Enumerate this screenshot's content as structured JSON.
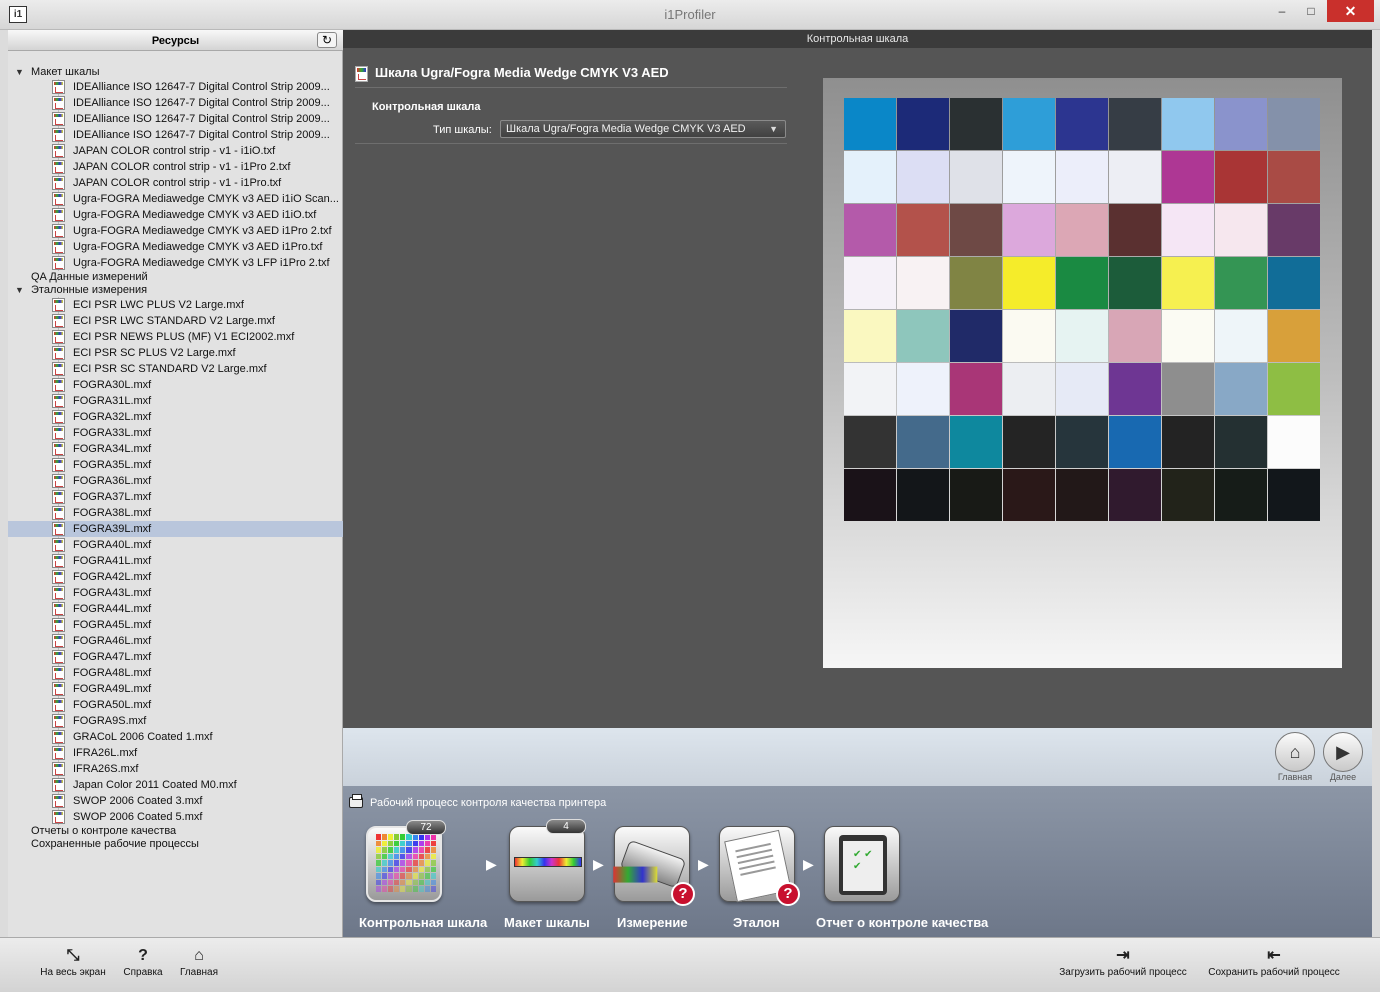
{
  "window": {
    "title": "i1Profiler",
    "icon": "i1",
    "minimize": "–",
    "maximize": "□",
    "close": "✕"
  },
  "sidebar": {
    "title": "Ресурсы",
    "refresh_icon": "↻",
    "tree": [
      {
        "kind": "folder",
        "label": "Макет шкалы",
        "expanded": true
      },
      {
        "kind": "file",
        "label": "IDEAlliance ISO 12647-7 Digital Control Strip 2009..."
      },
      {
        "kind": "file",
        "label": "IDEAlliance ISO 12647-7 Digital Control Strip 2009..."
      },
      {
        "kind": "file",
        "label": "IDEAlliance ISO 12647-7 Digital Control Strip 2009..."
      },
      {
        "kind": "file",
        "label": "IDEAlliance ISO 12647-7 Digital Control Strip 2009..."
      },
      {
        "kind": "file",
        "label": "JAPAN COLOR control strip - v1 - i1iO.txf"
      },
      {
        "kind": "file",
        "label": "JAPAN COLOR control strip - v1 - i1Pro 2.txf"
      },
      {
        "kind": "file",
        "label": "JAPAN COLOR control strip - v1 - i1Pro.txf"
      },
      {
        "kind": "file",
        "label": "Ugra-FOGRA Mediawedge CMYK v3 AED i1iO Scan..."
      },
      {
        "kind": "file",
        "label": "Ugra-FOGRA Mediawedge CMYK v3 AED i1iO.txf"
      },
      {
        "kind": "file",
        "label": "Ugra-FOGRA Mediawedge CMYK v3 AED i1Pro 2.txf"
      },
      {
        "kind": "file",
        "label": "Ugra-FOGRA Mediawedge CMYK v3 AED i1Pro.txf"
      },
      {
        "kind": "file",
        "label": "Ugra-FOGRA Mediawedge CMYK v3 LFP i1Pro 2.txf"
      },
      {
        "kind": "folder",
        "label": "QA Данные измерений",
        "expanded": false
      },
      {
        "kind": "folder",
        "label": "Эталонные измерения",
        "expanded": true
      },
      {
        "kind": "file",
        "label": "ECI PSR LWC PLUS V2 Large.mxf"
      },
      {
        "kind": "file",
        "label": "ECI PSR LWC STANDARD V2 Large.mxf"
      },
      {
        "kind": "file",
        "label": "ECI PSR NEWS PLUS (MF) V1 ECI2002.mxf"
      },
      {
        "kind": "file",
        "label": "ECI PSR SC PLUS V2 Large.mxf"
      },
      {
        "kind": "file",
        "label": "ECI PSR SC STANDARD V2 Large.mxf"
      },
      {
        "kind": "file",
        "label": "FOGRA30L.mxf"
      },
      {
        "kind": "file",
        "label": "FOGRA31L.mxf"
      },
      {
        "kind": "file",
        "label": "FOGRA32L.mxf"
      },
      {
        "kind": "file",
        "label": "FOGRA33L.mxf"
      },
      {
        "kind": "file",
        "label": "FOGRA34L.mxf"
      },
      {
        "kind": "file",
        "label": "FOGRA35L.mxf"
      },
      {
        "kind": "file",
        "label": "FOGRA36L.mxf"
      },
      {
        "kind": "file",
        "label": "FOGRA37L.mxf"
      },
      {
        "kind": "file",
        "label": "FOGRA38L.mxf"
      },
      {
        "kind": "file",
        "label": "FOGRA39L.mxf",
        "selected": true
      },
      {
        "kind": "file",
        "label": "FOGRA40L.mxf"
      },
      {
        "kind": "file",
        "label": "FOGRA41L.mxf"
      },
      {
        "kind": "file",
        "label": "FOGRA42L.mxf"
      },
      {
        "kind": "file",
        "label": "FOGRA43L.mxf"
      },
      {
        "kind": "file",
        "label": "FOGRA44L.mxf"
      },
      {
        "kind": "file",
        "label": "FOGRA45L.mxf"
      },
      {
        "kind": "file",
        "label": "FOGRA46L.mxf"
      },
      {
        "kind": "file",
        "label": "FOGRA47L.mxf"
      },
      {
        "kind": "file",
        "label": "FOGRA48L.mxf"
      },
      {
        "kind": "file",
        "label": "FOGRA49L.mxf"
      },
      {
        "kind": "file",
        "label": "FOGRA50L.mxf"
      },
      {
        "kind": "file",
        "label": "FOGRA9S.mxf"
      },
      {
        "kind": "file",
        "label": "GRACoL 2006 Coated 1.mxf"
      },
      {
        "kind": "file",
        "label": "IFRA26L.mxf"
      },
      {
        "kind": "file",
        "label": "IFRA26S.mxf"
      },
      {
        "kind": "file",
        "label": "Japan Color 2011 Coated M0.mxf"
      },
      {
        "kind": "file",
        "label": "SWOP 2006 Coated 3.mxf"
      },
      {
        "kind": "file",
        "label": "SWOP 2006 Coated 5.mxf"
      },
      {
        "kind": "folder",
        "label": "Отчеты о контроле качества",
        "expanded": false
      },
      {
        "kind": "folder",
        "label": "Сохраненные рабочие процессы",
        "expanded": false
      }
    ]
  },
  "main": {
    "tab": "Контрольная шкала",
    "strip_title": "Шкала Ugra/Fogra Media Wedge CMYK V3 AED",
    "section_label": "Контрольная шкала",
    "type_label": "Тип шкалы:",
    "type_value": "Шкала Ugra/Fogra Media Wedge CMYK V3 AED",
    "patches": [
      "#0a87c8",
      "#1c2a78",
      "#2a3032",
      "#2e9ed8",
      "#2c3590",
      "#363d45",
      "#90c8ee",
      "#8a93cc",
      "#8491aa",
      "#e4f1fb",
      "#dcdef4",
      "#dfe1e8",
      "#eef4fb",
      "#eceefa",
      "#edeef4",
      "#ae3794",
      "#a93535",
      "#a94b45",
      "#b45aaa",
      "#b3524b",
      "#6e4945",
      "#dca8dc",
      "#dca7b5",
      "#5a3030",
      "#f5e6f5",
      "#f6e7ee",
      "#683a68",
      "#f5f1f8",
      "#f8f2f3",
      "#808444",
      "#f5ec2a",
      "#1a8a42",
      "#1c5c3a",
      "#f6f050",
      "#349554",
      "#116d98",
      "#faf8c0",
      "#8ec6bc",
      "#202a68",
      "#fbfaf2",
      "#e6f3f2",
      "#d8a6b6",
      "#fbfbf3",
      "#eef5f9",
      "#d8a03a",
      "#f2f3f6",
      "#eef2fb",
      "#a93677",
      "#eceef2",
      "#e6eaf6",
      "#6e3693",
      "#8e8e8e",
      "#88a8c6",
      "#8ebe44",
      "#333333",
      "#446a8b",
      "#0e889e",
      "#242424",
      "#26353c",
      "#1869b1",
      "#232323",
      "#243032",
      "#fcfcfc",
      "#1a1218",
      "#131619",
      "#181a16",
      "#2a1818",
      "#221818",
      "#301a2e",
      "#22231a",
      "#161c18",
      "#12171b"
    ]
  },
  "nav": {
    "home_label": "Главная",
    "next_label": "Далее",
    "home_icon": "⌂",
    "next_icon": "▶"
  },
  "workflow": {
    "title": "Рабочий процесс контроля качества принтера",
    "steps": [
      {
        "label": "Контрольная шкала",
        "badge": "72"
      },
      {
        "label": "Макет шкалы",
        "badge": "4"
      },
      {
        "label": "Измерение",
        "warning": "?"
      },
      {
        "label": "Эталон",
        "warning": "?"
      },
      {
        "label": "Отчет о контроле качества"
      }
    ],
    "arrow": "▶"
  },
  "bottom": {
    "fullscreen": "На весь экран",
    "help": "Справка",
    "home": "Главная",
    "load": "Загрузить рабочий процесс",
    "save": "Сохранить рабочий процесс"
  }
}
